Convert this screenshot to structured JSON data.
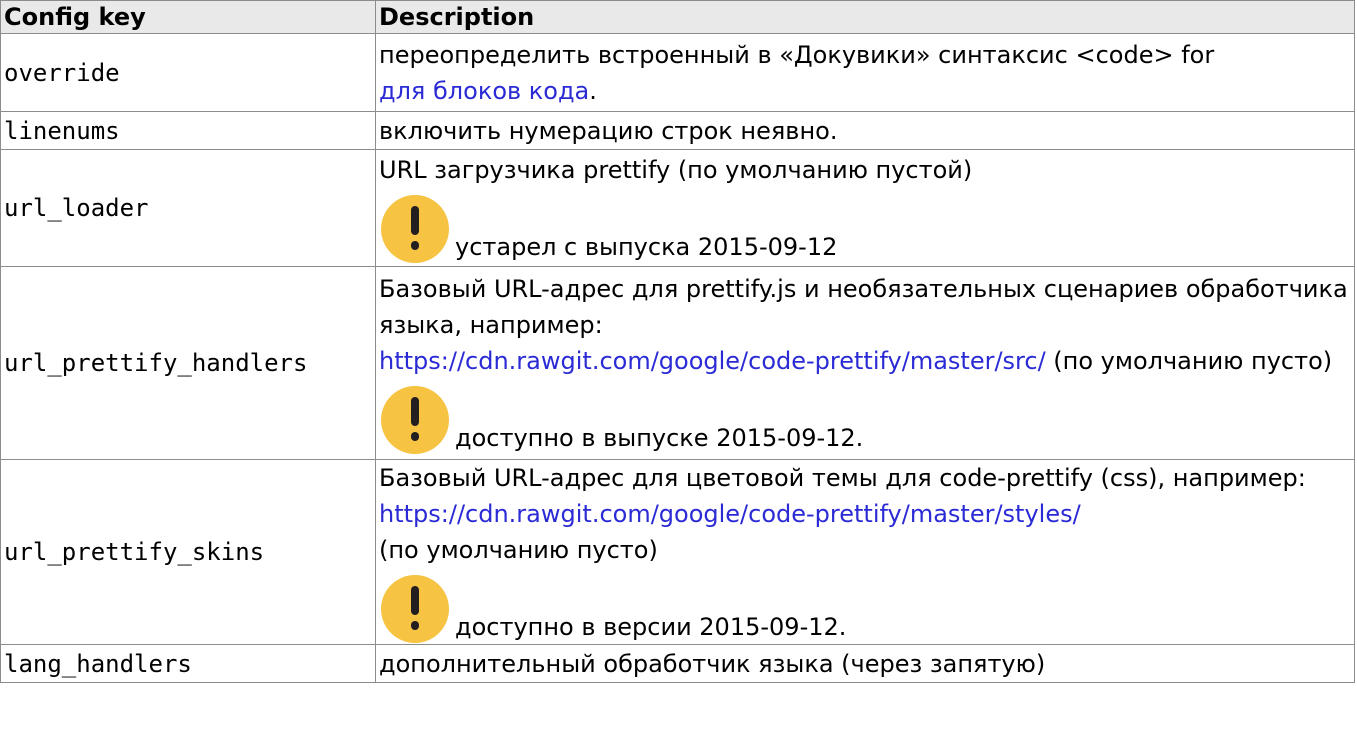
{
  "table": {
    "headers": {
      "key": "Config key",
      "description": "Description"
    },
    "rows": [
      {
        "key": "override",
        "text_before": "переопределить встроенный в «Докувики» синтаксис <code> for",
        "link": "для блоков кода",
        "text_after": "."
      },
      {
        "key": "linenums",
        "text": "включить нумерацию строк неявно."
      },
      {
        "key": "url_loader",
        "text": "URL загрузчика prettify (по умолчанию пустой)",
        "note": "устарел с выпуска 2015-09-12"
      },
      {
        "key": "url_prettify_handlers",
        "text_before": "Базовый URL-адрес для prettify.js и необязательных сценариев обработчика языка, например:",
        "link": "https://cdn.rawgit.com/google/code-prettify/master/src/",
        "text_after": " (по умолчанию пусто)",
        "note": "доступно в выпуске 2015-09-12."
      },
      {
        "key": "url_prettify_skins",
        "text_before": "Базовый URL-адрес для цветовой темы для code-prettify (css), например:",
        "link": "https://cdn.rawgit.com/google/code-prettify/master/styles/",
        "text_after": "(по умолчанию пусто)",
        "note": "доступно в версии 2015-09-12."
      },
      {
        "key": "lang_handlers",
        "text": "дополнительный обработчик языка (через запятую)"
      }
    ]
  },
  "icons": {
    "warning": "exclamation-warning-icon"
  },
  "colors": {
    "header_bg": "#e9e9e9",
    "border": "#8c8c8c",
    "link": "#2b2bd6",
    "warning_circle": "#f6c342"
  }
}
